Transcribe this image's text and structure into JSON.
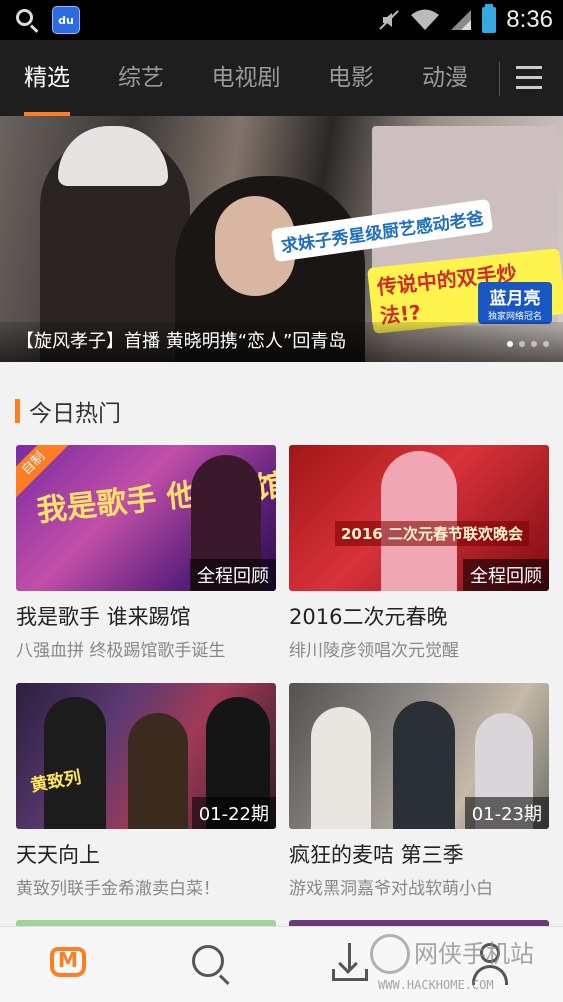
{
  "status_bar": {
    "time": "8:36",
    "baidu_label": "du"
  },
  "top_nav": {
    "tabs": [
      {
        "label": "精选",
        "active": true
      },
      {
        "label": "综艺",
        "active": false
      },
      {
        "label": "电视剧",
        "active": false
      },
      {
        "label": "电影",
        "active": false
      },
      {
        "label": "动漫",
        "active": false
      }
    ],
    "menu_icon": "hamburger-menu-icon",
    "accent_color": "#ff7e24"
  },
  "banner": {
    "caption": "【旋风孝子】首播 黄晓明携“恋人”回青岛",
    "sticker_1": "求妹子秀星级厨艺感动老爸",
    "sticker_2": "传说中的双手炒法!?",
    "brand_name": "蓝月亮",
    "brand_tagline": "独家网络冠名",
    "page_count": 4,
    "active_page": 1
  },
  "section": {
    "title": "今日热门"
  },
  "cards": [
    {
      "title": "我是歌手 谁来踢馆",
      "subtitle": "八强血拼 终极踢馆歌手诞生",
      "badge": "全程回顾",
      "corner_tag": "自制",
      "poster_text": "我是歌手 他来踢馆"
    },
    {
      "title": "2016二次元春晚",
      "subtitle": "绯川陵彦领唱次元觉醒",
      "badge": "全程回顾",
      "poster_text": "2016 二次元春节联欢晚会"
    },
    {
      "title": "天天向上",
      "subtitle": "黄致列联手金希澈卖白菜！",
      "badge": "01-22期",
      "poster_text": "黄致列"
    },
    {
      "title": "疯狂的麦咭 第三季",
      "subtitle": "游戏黑洞嘉爷对战软萌小白",
      "badge": "01-23期"
    }
  ],
  "bottom_bar": {
    "items": [
      {
        "icon": "home-logo-icon",
        "active": true
      },
      {
        "icon": "search-icon",
        "active": false
      },
      {
        "icon": "download-icon",
        "active": false
      },
      {
        "icon": "user-icon",
        "active": false
      }
    ]
  },
  "watermark": {
    "name": "网侠手机站",
    "url": "WWW.HACKHOME.COM"
  }
}
